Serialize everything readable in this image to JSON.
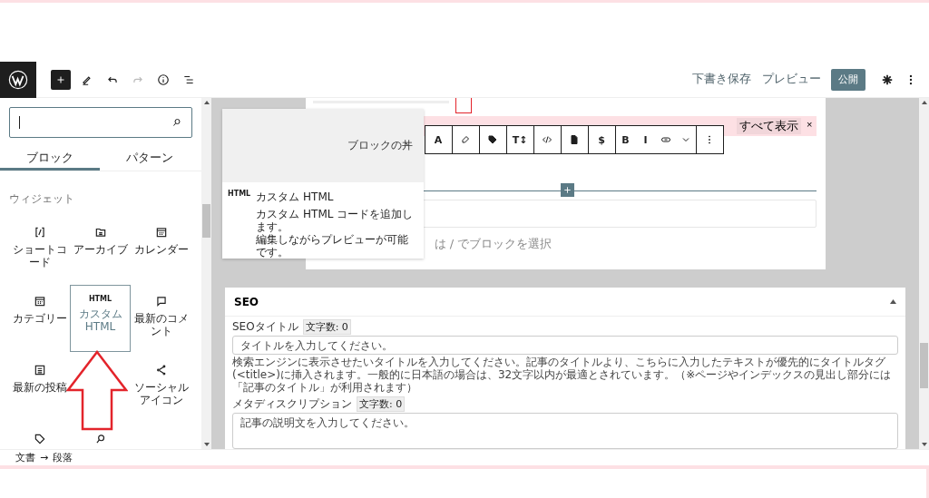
{
  "top_bar": {
    "save_draft": "下書き保存",
    "preview": "プレビュー",
    "publish": "公開"
  },
  "sidebar": {
    "tabs": [
      {
        "label": "ブロック",
        "selected": true
      },
      {
        "label": "パターン",
        "selected": false
      }
    ],
    "section_title": "ウィジェット",
    "blocks": [
      {
        "label": "ショートコード",
        "selected": false
      },
      {
        "label": "アーカイブ",
        "selected": false
      },
      {
        "label": "カレンダー",
        "selected": false
      },
      {
        "label": "カテゴリー",
        "selected": false
      },
      {
        "label": "カスタム HTML",
        "icon_text": "HTML",
        "selected": true
      },
      {
        "label": "最新のコメント",
        "selected": false
      },
      {
        "label": "最新の投稿",
        "selected": false
      },
      {
        "label": "ソーシャルアイコン",
        "selected": false
      },
      {
        "selected": false
      },
      {
        "selected": false
      }
    ]
  },
  "popover": {
    "preview_text": "ブロックの丼",
    "icon_text": "HTML",
    "title": "カスタム HTML",
    "description": [
      "カスタム HTML コードを追加します。",
      "編集しながらプレビューが可能です。"
    ]
  },
  "editor": {
    "notice": {
      "button": "すべて表示",
      "close": "×"
    },
    "block_toolbar": [
      {
        "kind": "text",
        "label": "A"
      },
      {
        "kind": "icon"
      },
      {
        "kind": "icon"
      },
      {
        "kind": "text",
        "label": "T↕"
      },
      {
        "kind": "icon"
      },
      {
        "kind": "icon"
      },
      {
        "kind": "text",
        "label": "$"
      },
      {
        "kind": "text",
        "label": "B"
      },
      {
        "kind": "text",
        "label": "I"
      },
      {
        "kind": "icon"
      },
      {
        "kind": "icon"
      },
      {
        "kind": "icon"
      }
    ],
    "placeholder": "は / でブロックを選択"
  },
  "seo": {
    "title": "SEO",
    "expanded": true,
    "fields": [
      {
        "kind": "input",
        "label": "SEOタイトル",
        "count": "文字数: 0",
        "placeholder": "タイトルを入力してください。",
        "help": "検索エンジンに表示させたいタイトルを入力してください。記事のタイトルより、こちらに入力したテキストが優先的にタイトルタグ(<title>)に挿入されます。一般的に日本語の場合は、32文字以内が最適とされています。（※ページやインデックスの見出し部分には「記事のタイトル」が利用されます）"
      },
      {
        "kind": "textarea",
        "label": "メタディスクリプション",
        "count": "文字数: 0",
        "placeholder": "記事の説明文を入力してください。"
      }
    ]
  },
  "breadcrumb": {
    "items": [
      "文書",
      "段落"
    ],
    "separator": "→"
  }
}
